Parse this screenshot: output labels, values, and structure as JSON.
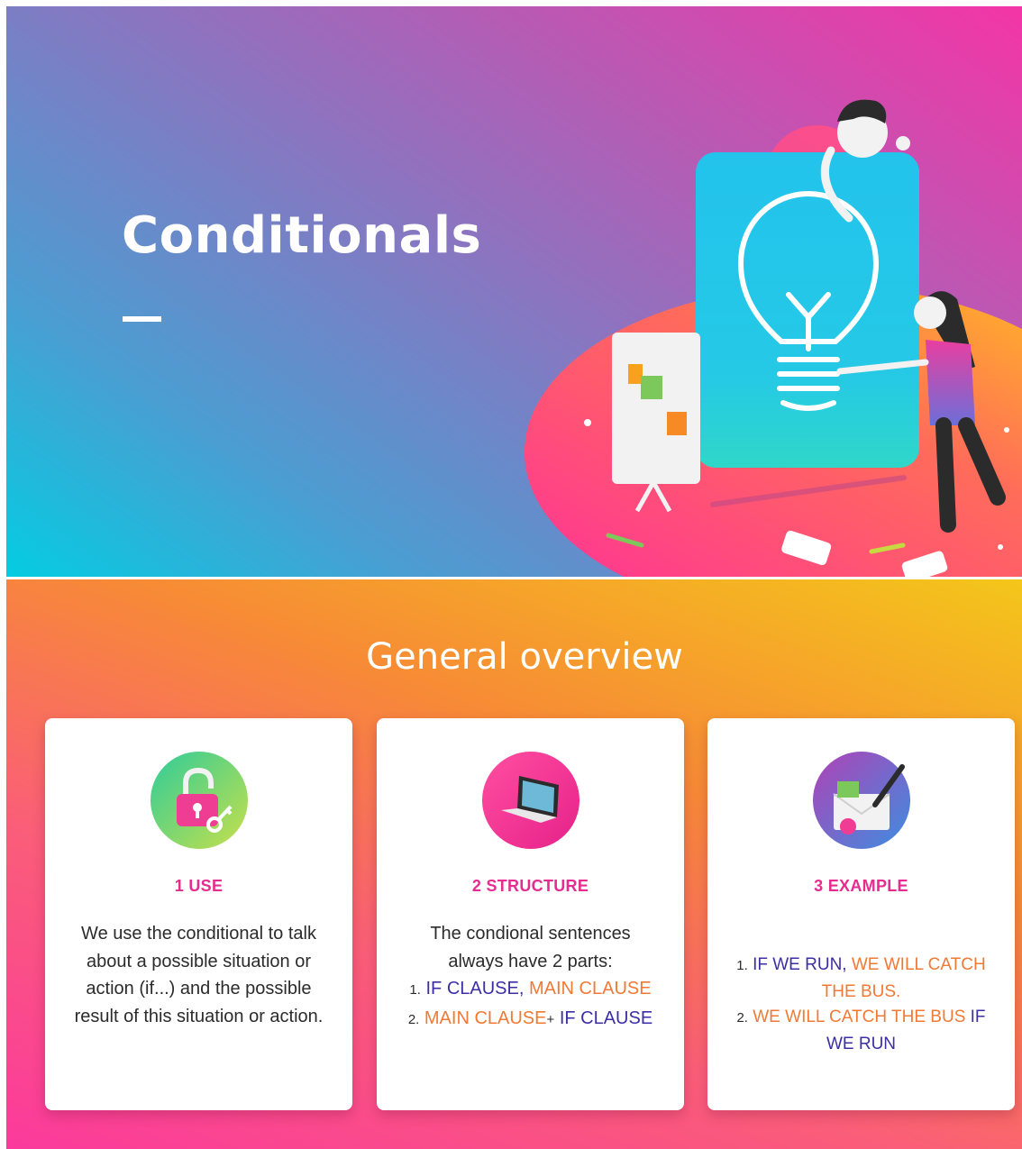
{
  "hero": {
    "title": "Conditionals"
  },
  "overview": {
    "title": "General overview",
    "cards": [
      {
        "icon": "padlock-key-icon",
        "heading": "1 USE",
        "body": "We use the conditional to talk about a possible situation or action (if...) and the possible result of this situation or action."
      },
      {
        "icon": "laptop-icon",
        "heading": "2 STRUCTURE",
        "intro": "The condional sentences always have 2 parts:",
        "items": [
          {
            "number": "1.",
            "a": "IF CLAUSE",
            "sep": ",",
            "b": "MAIN CLAUSE"
          },
          {
            "number": "2.",
            "a": "MAIN CLAUSE",
            "sep": "+",
            "b": "IF CLAUSE"
          }
        ]
      },
      {
        "icon": "letter-pen-icon",
        "heading": "3 EXAMPLE",
        "items": [
          {
            "number": "1.",
            "a": "IF WE RUN",
            "sep": ",",
            "b": "WE WILL CATCH THE BUS",
            "end": "."
          },
          {
            "number": "2.",
            "a": "WE WILL CATCH THE BUS",
            "b": "IF WE RUN"
          }
        ]
      }
    ]
  },
  "colors": {
    "heading": "#e62c8e",
    "clause_blue": "#3c2fa6",
    "clause_orange": "#f07a35"
  }
}
